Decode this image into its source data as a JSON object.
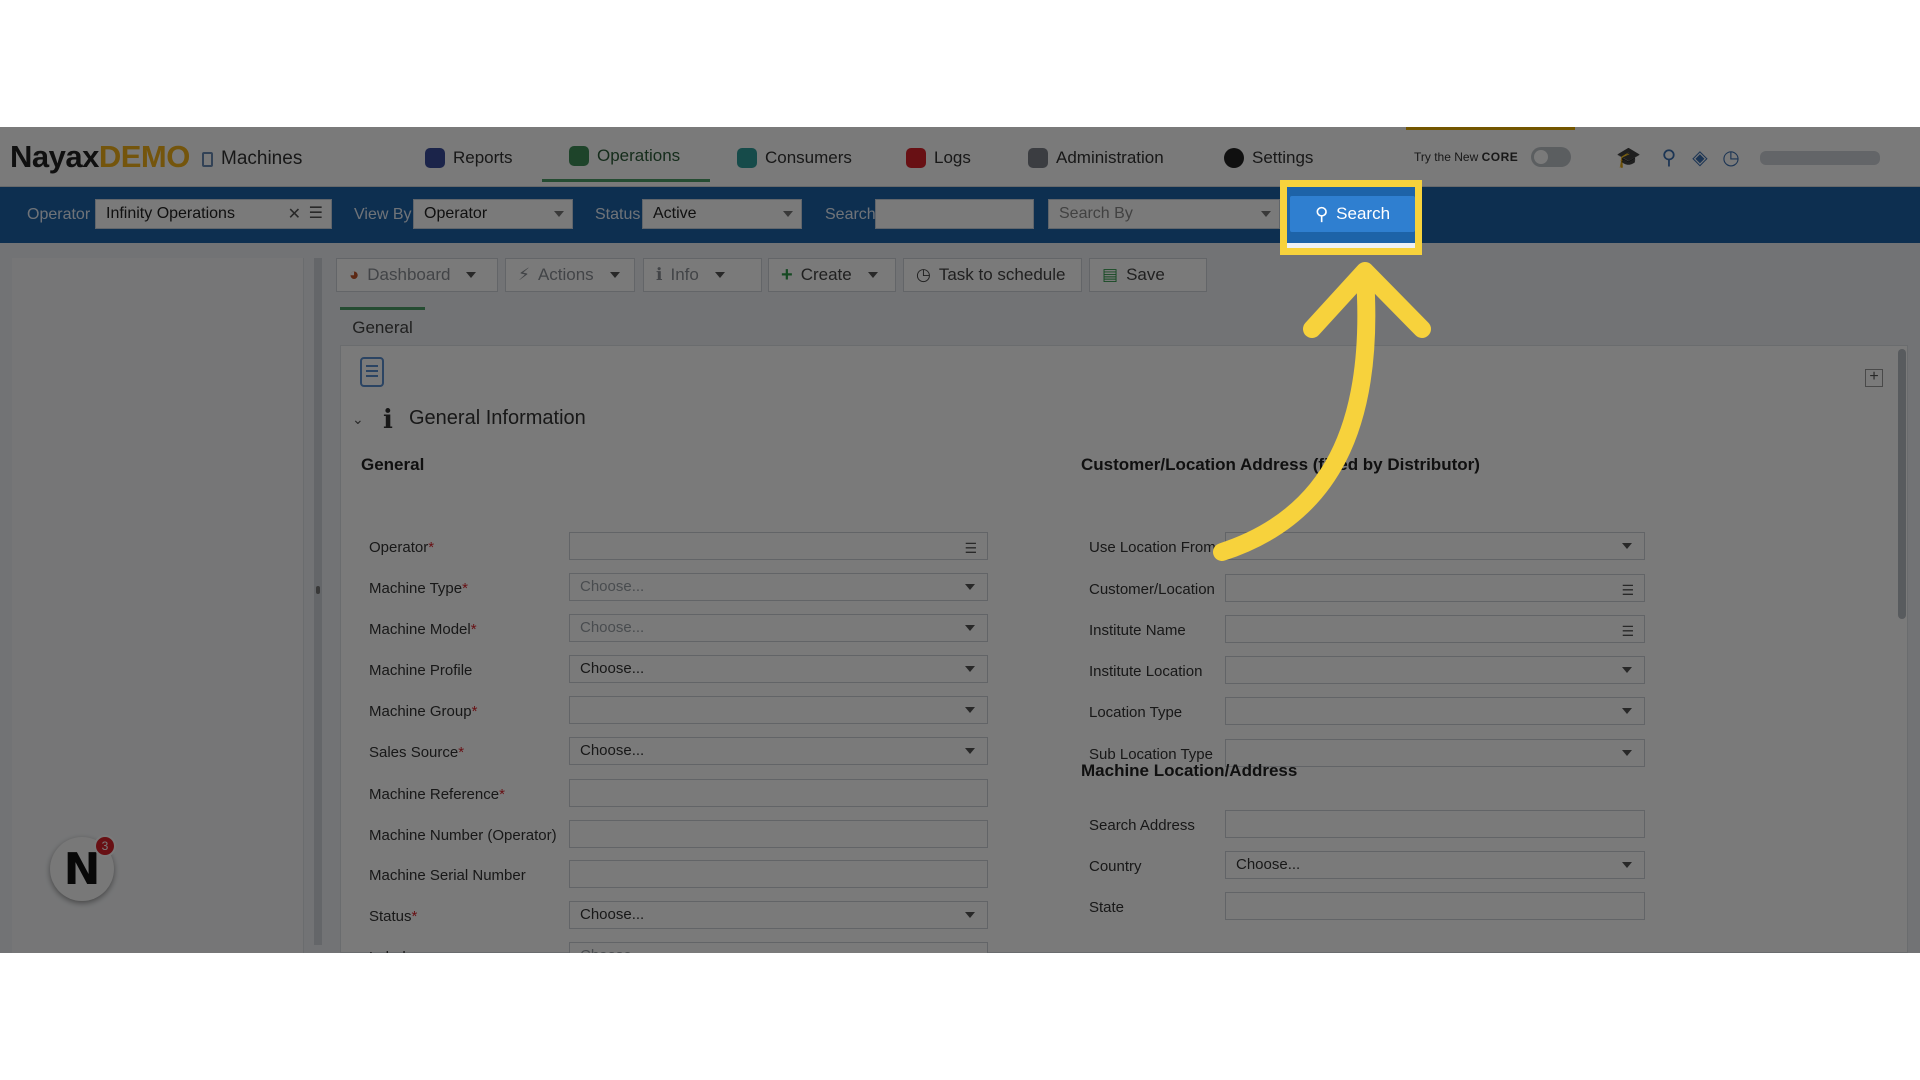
{
  "app": {
    "logo_main": "Nayax",
    "logo_suffix": "DEMO",
    "module": "Machines"
  },
  "nav": {
    "items": [
      {
        "label": "Reports"
      },
      {
        "label": "Operations"
      },
      {
        "label": "Consumers"
      },
      {
        "label": "Logs"
      },
      {
        "label": "Administration"
      },
      {
        "label": "Settings"
      }
    ],
    "core_prefix": "Try the New",
    "core_name": "CORE"
  },
  "filter": {
    "operator_label": "Operator",
    "operator_value": "Infinity Operations",
    "viewby_label": "View By",
    "viewby_value": "Operator",
    "status_label": "Status",
    "status_value": "Active",
    "search_label": "Search",
    "search_value": "",
    "searchby_placeholder": "Search By",
    "search_button": "Search"
  },
  "toolbar": {
    "dashboard": "Dashboard",
    "actions": "Actions",
    "info": "Info",
    "create": "Create",
    "task": "Task to schedule",
    "save": "Save"
  },
  "tabs": {
    "general": "General"
  },
  "section": {
    "title": "General Information"
  },
  "left": {
    "title": "General",
    "rows": [
      {
        "label": "Operator",
        "required": "*",
        "value": "",
        "kind": "list"
      },
      {
        "label": "Machine Type",
        "required": "*",
        "value": "Choose...",
        "kind": "select-ph"
      },
      {
        "label": "Machine Model",
        "required": "*",
        "value": "Choose...",
        "kind": "select-ph"
      },
      {
        "label": "Machine Profile",
        "required": "",
        "value": "Choose...",
        "kind": "select"
      },
      {
        "label": "Machine Group",
        "required": "*",
        "value": "",
        "kind": "select"
      },
      {
        "label": "Sales Source",
        "required": "*",
        "value": "Choose...",
        "kind": "select"
      },
      {
        "label": "Machine Reference",
        "required": "*",
        "value": "",
        "kind": "text"
      },
      {
        "label": "Machine Number (Operator)",
        "required": "",
        "value": "",
        "kind": "text"
      },
      {
        "label": "Machine Serial Number",
        "required": "",
        "value": "",
        "kind": "text"
      },
      {
        "label": "Status",
        "required": "*",
        "value": "Choose...",
        "kind": "select"
      },
      {
        "label": "Labels",
        "required": "",
        "value": "Choose...",
        "kind": "text-ph"
      }
    ]
  },
  "right": {
    "title": "Customer/Location Address (filled by Distributor)",
    "rows": [
      {
        "label": "Use Location From",
        "kind": "select"
      },
      {
        "label": "Customer/Location",
        "kind": "list"
      },
      {
        "label": "Institute Name",
        "kind": "list"
      },
      {
        "label": "Institute Location",
        "kind": "select"
      },
      {
        "label": "Location Type",
        "kind": "select"
      },
      {
        "label": "Sub Location Type",
        "kind": "select"
      }
    ],
    "title2": "Machine Location/Address",
    "rows2": [
      {
        "label": "Search Address",
        "value": "",
        "kind": "text"
      },
      {
        "label": "Country",
        "value": "Choose...",
        "kind": "select"
      },
      {
        "label": "State",
        "value": "",
        "kind": "text"
      }
    ]
  },
  "notifications": {
    "count": "3",
    "avatar_letter": "N"
  }
}
